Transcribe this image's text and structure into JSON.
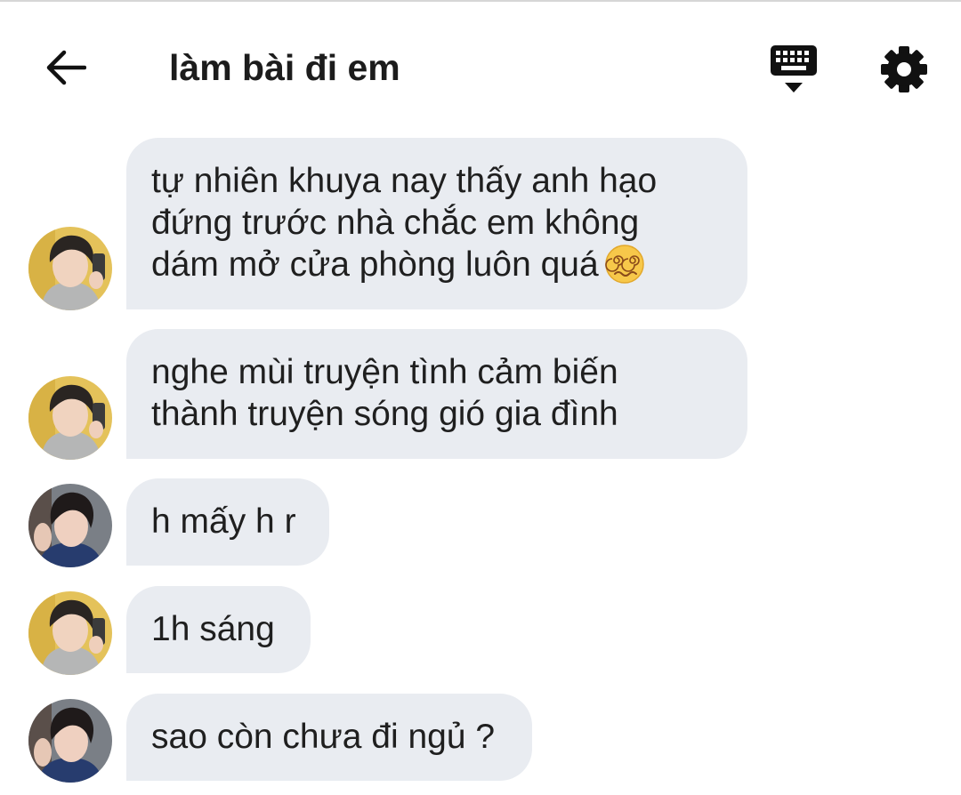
{
  "header": {
    "back_icon": "arrow-left-icon",
    "title": "làm bài đi em",
    "keyboard_icon": "keyboard-hide-icon",
    "settings_icon": "gear-icon"
  },
  "messages": [
    {
      "avatar": "avatar-1",
      "lines": [
        "tự nhiên khuya nay thấy anh hạo",
        "đứng trước nhà chắc em không",
        "dám mở cửa phòng luôn quá"
      ],
      "emoji": "dizzy-face-emoji"
    },
    {
      "avatar": "avatar-1",
      "lines": [
        "nghe mùi truyện tình cảm biến",
        "thành truyện sóng gió gia đình"
      ]
    },
    {
      "avatar": "avatar-2",
      "lines": [
        "h mấy h r"
      ]
    },
    {
      "avatar": "avatar-1",
      "lines": [
        "1h sáng"
      ]
    },
    {
      "avatar": "avatar-2",
      "lines": [
        "sao còn chưa đi ngủ ?"
      ]
    }
  ],
  "colors": {
    "bubble": "#e9ecf1",
    "text": "#1f1f1f",
    "background": "#ffffff"
  }
}
